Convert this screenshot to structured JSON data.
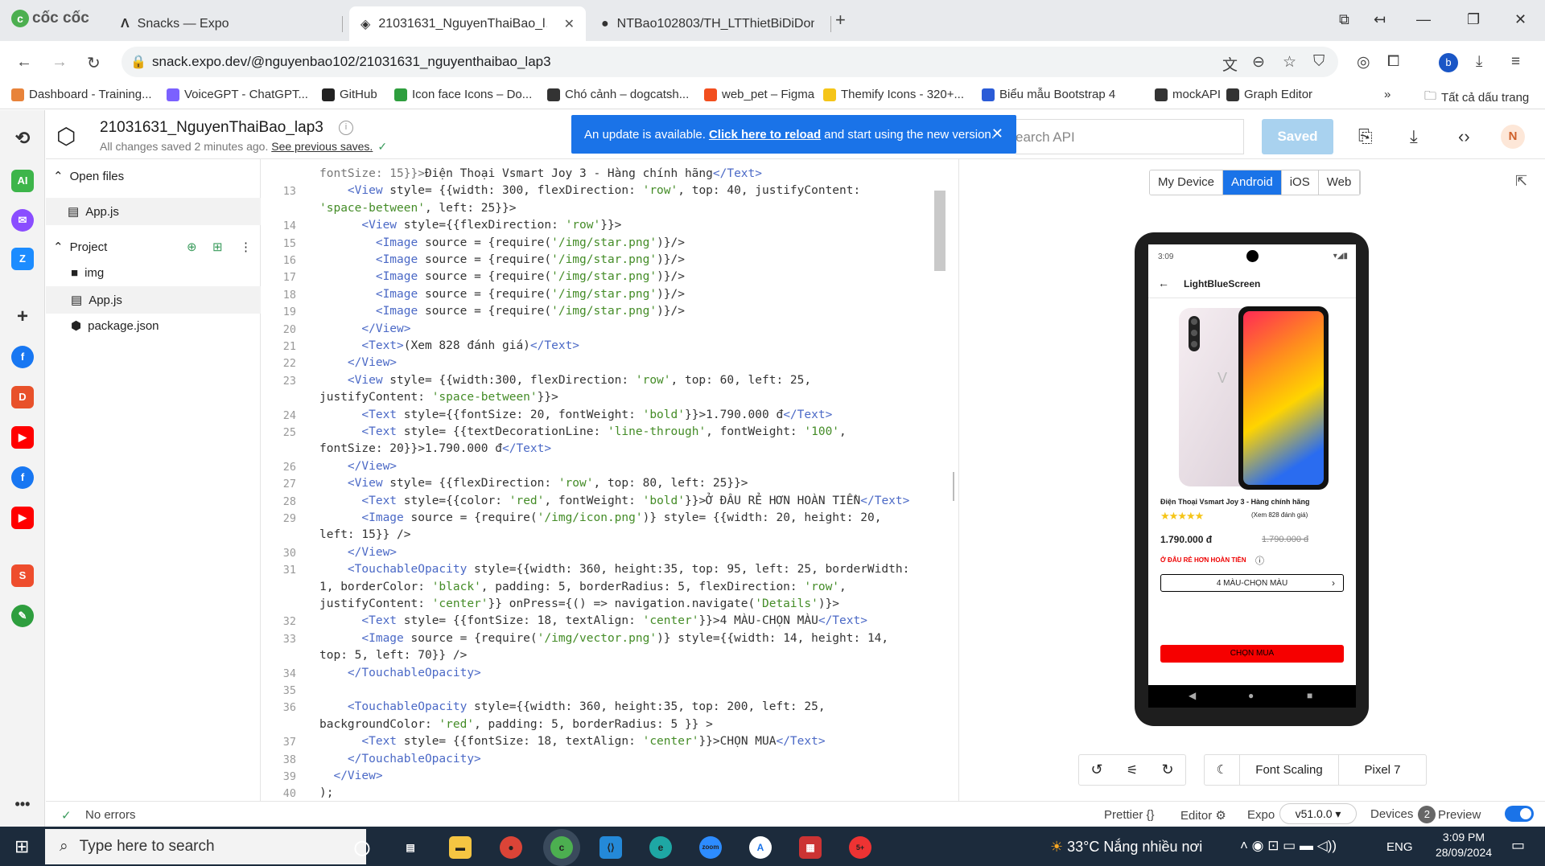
{
  "browser": {
    "logo": "cốc cốc",
    "tabs": [
      {
        "title": "Snacks — Expo",
        "active": false
      },
      {
        "title": "21031631_NguyenThaiBao_l…",
        "active": true
      },
      {
        "title": "NTBao102803/TH_LTThietBiDiDon…",
        "active": false
      }
    ],
    "url": "snack.expo.dev/@nguyenbao102/21031631_nguyenthaibao_lap3",
    "profile_initial": "b",
    "bookmarks": [
      {
        "label": "Dashboard - Training...",
        "color": "#e8833a"
      },
      {
        "label": "VoiceGPT - ChatGPT...",
        "color": "#7b61ff"
      },
      {
        "label": "GitHub",
        "color": "#222"
      },
      {
        "label": "Icon face Icons – Do...",
        "color": "#2e9e3e"
      },
      {
        "label": "Chó cảnh – dogcatsh...",
        "color": "#333"
      },
      {
        "label": "web_pet – Figma",
        "color": "#f24e1e"
      },
      {
        "label": "Themify Icons - 320+...",
        "color": "#f5c518"
      },
      {
        "label": "Biểu mẫu Bootstrap 4",
        "color": "#2a5bd7"
      },
      {
        "label": "mockAPI",
        "color": "#333"
      },
      {
        "label": "Graph Editor",
        "color": "#333"
      }
    ],
    "all_bookmarks": "Tất cả dấu trang"
  },
  "snack": {
    "project_title": "21031631_NguyenThaiBao_lap3",
    "saved_status": "All changes saved 2 minutes ago.",
    "see_previous": "See previous saves.",
    "update_banner": {
      "prefix": "An update is available.",
      "link": "Click here to reload",
      "suffix": "and start using the new version."
    },
    "search_placeholder": "earch API",
    "saved_button": "Saved",
    "avatar_initial": "N"
  },
  "files": {
    "open_files_label": "Open files",
    "open_files": [
      "App.js"
    ],
    "project_label": "Project",
    "project_items": [
      {
        "name": "img",
        "kind": "folder"
      },
      {
        "name": "App.js",
        "kind": "file"
      },
      {
        "name": "package.json",
        "kind": "file"
      }
    ]
  },
  "editor": {
    "lines": [
      {
        "n": "",
        "html": "<span class=\"w\">fontSize: 15}}></span>Điện Thoại Vsmart Joy 3 - Hàng chính hãng<span class=\"t\">&lt;/Text&gt;</span>"
      },
      {
        "n": "13",
        "html": "    <span class=\"t\">&lt;View</span> style= {{width: 300, flexDirection: <span class=\"s\">'row'</span>, top: 40, justifyContent:"
      },
      {
        "n": "",
        "html": "<span class=\"s\">'space-between'</span>, left: 25}}>"
      },
      {
        "n": "14",
        "html": "      <span class=\"t\">&lt;View</span> style={{flexDirection: <span class=\"s\">'row'</span>}}>"
      },
      {
        "n": "15",
        "html": "        <span class=\"t\">&lt;Image</span> source = {require(<span class=\"s\">'/img/star.png'</span>)}/>"
      },
      {
        "n": "16",
        "html": "        <span class=\"t\">&lt;Image</span> source = {require(<span class=\"s\">'/img/star.png'</span>)}/>"
      },
      {
        "n": "17",
        "html": "        <span class=\"t\">&lt;Image</span> source = {require(<span class=\"s\">'/img/star.png'</span>)}/>"
      },
      {
        "n": "18",
        "html": "        <span class=\"t\">&lt;Image</span> source = {require(<span class=\"s\">'/img/star.png'</span>)}/>"
      },
      {
        "n": "19",
        "html": "        <span class=\"t\">&lt;Image</span> source = {require(<span class=\"s\">'/img/star.png'</span>)}/>"
      },
      {
        "n": "20",
        "html": "      <span class=\"t\">&lt;/View&gt;</span>"
      },
      {
        "n": "21",
        "html": "      <span class=\"t\">&lt;Text&gt;</span>(Xem 828 đánh giá)<span class=\"t\">&lt;/Text&gt;</span>"
      },
      {
        "n": "22",
        "html": "    <span class=\"t\">&lt;/View&gt;</span>"
      },
      {
        "n": "23",
        "html": "    <span class=\"t\">&lt;View</span> style= {{width:300, flexDirection: <span class=\"s\">'row'</span>, top: 60, left: 25,"
      },
      {
        "n": "",
        "html": "justifyContent: <span class=\"s\">'space-between'</span>}}>"
      },
      {
        "n": "24",
        "html": "      <span class=\"t\">&lt;Text</span> style={{fontSize: 20, fontWeight: <span class=\"s\">'bold'</span>}}>1.790.000 đ<span class=\"t\">&lt;/Text&gt;</span>"
      },
      {
        "n": "25",
        "html": "      <span class=\"t\">&lt;Text</span> style= {{textDecorationLine: <span class=\"s\">'line-through'</span>, fontWeight: <span class=\"s\">'100'</span>,"
      },
      {
        "n": "",
        "html": "fontSize: 20}}>1.790.000 đ<span class=\"t\">&lt;/Text&gt;</span>"
      },
      {
        "n": "26",
        "html": "    <span class=\"t\">&lt;/View&gt;</span>"
      },
      {
        "n": "27",
        "html": "    <span class=\"t\">&lt;View</span> style= {{flexDirection: <span class=\"s\">'row'</span>, top: 80, left: 25}}>"
      },
      {
        "n": "28",
        "html": "      <span class=\"t\">&lt;Text</span> style={{color: <span class=\"s\">'red'</span>, fontWeight: <span class=\"s\">'bold'</span>}}>Ở ĐÂU RẺ HƠN HOÀN TIỀN<span class=\"t\">&lt;/Text&gt;</span>"
      },
      {
        "n": "29",
        "html": "      <span class=\"t\">&lt;Image</span> source = {require(<span class=\"s\">'/img/icon.png'</span>)} style= {{width: 20, height: 20,"
      },
      {
        "n": "",
        "html": "left: 15}} />"
      },
      {
        "n": "30",
        "html": "    <span class=\"t\">&lt;/View&gt;</span>"
      },
      {
        "n": "31",
        "html": "    <span class=\"t\">&lt;TouchableOpacity</span> style={{width: 360, height:35, top: 95, left: 25, borderWidth:"
      },
      {
        "n": "",
        "html": "1, borderColor: <span class=\"s\">'black'</span>, padding: 5, borderRadius: 5, flexDirection: <span class=\"s\">'row'</span>,"
      },
      {
        "n": "",
        "html": "justifyContent: <span class=\"s\">'center'</span>}} onPress={() => navigation.navigate(<span class=\"s\">'Details'</span>)}>"
      },
      {
        "n": "32",
        "html": "      <span class=\"t\">&lt;Text</span> style= {{fontSize: 18, textAlign: <span class=\"s\">'center'</span>}}>4 MÀU-CHỌN MÀU<span class=\"t\">&lt;/Text&gt;</span>"
      },
      {
        "n": "33",
        "html": "      <span class=\"t\">&lt;Image</span> source = {require(<span class=\"s\">'/img/vector.png'</span>)} style={{width: 14, height: 14,"
      },
      {
        "n": "",
        "html": "top: 5, left: 70}} />"
      },
      {
        "n": "34",
        "html": "    <span class=\"t\">&lt;/TouchableOpacity&gt;</span>"
      },
      {
        "n": "35",
        "html": ""
      },
      {
        "n": "36",
        "html": "    <span class=\"t\">&lt;TouchableOpacity</span> style={{width: 360, height:35, top: 200, left: 25,"
      },
      {
        "n": "",
        "html": "backgroundColor: <span class=\"s\">'red'</span>, padding: 5, borderRadius: 5 }} >"
      },
      {
        "n": "37",
        "html": "      <span class=\"t\">&lt;Text</span> style= {{fontSize: 18, textAlign: <span class=\"s\">'center'</span>}}>CHỌN MUA<span class=\"t\">&lt;/Text&gt;</span>"
      },
      {
        "n": "38",
        "html": "    <span class=\"t\">&lt;/TouchableOpacity&gt;</span>"
      },
      {
        "n": "39",
        "html": "  <span class=\"t\">&lt;/View&gt;</span>"
      },
      {
        "n": "40",
        "html": ");"
      }
    ]
  },
  "preview": {
    "device_tabs": [
      "My Device",
      "Android",
      "iOS",
      "Web"
    ],
    "active_tab": "Android",
    "phone": {
      "time": "3:09",
      "screen_title": "LightBlueScreen",
      "product_name": "Điện Thoại Vsmart Joy 3 - Hàng chính hãng",
      "reviews": "(Xem 828 đánh giá)",
      "price": "1.790.000 đ",
      "old_price": "1.790.000 đ",
      "promo": "Ở ĐÂU RẺ HƠN HOÀN TIỀN",
      "variant_button": "4 MÀU-CHỌN MÀU",
      "buy_button": "CHỌN MUA",
      "rating_stars": 5
    },
    "font_scaling": "Font Scaling",
    "device_name": "Pixel 7"
  },
  "footer": {
    "status": "No errors",
    "prettier": "Prettier",
    "editor": "Editor",
    "expo": "Expo",
    "sdk": "v51.0.0 ▾",
    "devices": "Devices",
    "devices_count": "2",
    "preview": "Preview"
  },
  "taskbar": {
    "search_placeholder": "Type here to search",
    "weather_temp": "33°C",
    "weather_text": "Nắng nhiều nơi",
    "language": "ENG",
    "time": "3:09 PM",
    "date": "28/09/2024",
    "notification_count": "5+"
  }
}
